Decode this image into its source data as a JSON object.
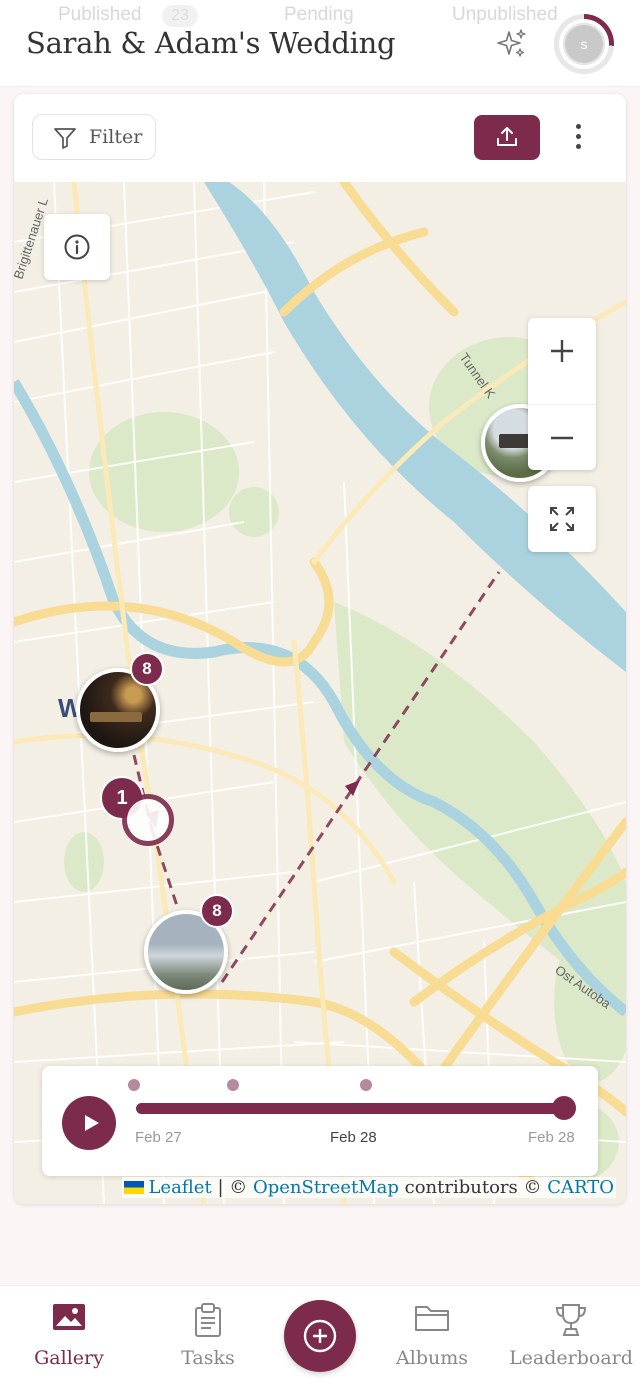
{
  "header": {
    "title": "Sarah & Adam's Wedding",
    "ghost_tabs": [
      "Published",
      "Pending",
      "Unpublished"
    ],
    "ghost_count": "23",
    "avatar_initial": "s",
    "avatar_progress": 0.26
  },
  "toolbar": {
    "filter_label": "Filter"
  },
  "map": {
    "labels": {
      "road_top_left": "Brigittenauer L",
      "tunnel": "Tunnel K",
      "autobahn": "Ost Autoba",
      "city_fragment": "W"
    },
    "markers": [
      {
        "count": "8"
      },
      {
        "count": "8"
      },
      {
        "count": "1"
      }
    ],
    "attribution": {
      "leaflet": "Leaflet",
      "osm_prefix": "| ©",
      "osm": "OpenStreetMap",
      "contributors": "contributors ©",
      "carto": "CARTO"
    }
  },
  "timeline": {
    "labels": [
      "Feb 27",
      "Feb 28",
      "Feb 28"
    ],
    "progress": 1.0
  },
  "nav": {
    "items": [
      {
        "label": "Gallery",
        "icon": "image-icon",
        "active": true
      },
      {
        "label": "Tasks",
        "icon": "clipboard-icon",
        "active": false
      },
      {
        "label": "Albums",
        "icon": "folder-icon",
        "active": false
      },
      {
        "label": "Leaderboard",
        "icon": "trophy-icon",
        "active": false
      }
    ]
  },
  "colors": {
    "brand": "#7c2b4c",
    "water": "#aad3df",
    "park": "#d9e8c6",
    "road": "#fbe3a0"
  }
}
